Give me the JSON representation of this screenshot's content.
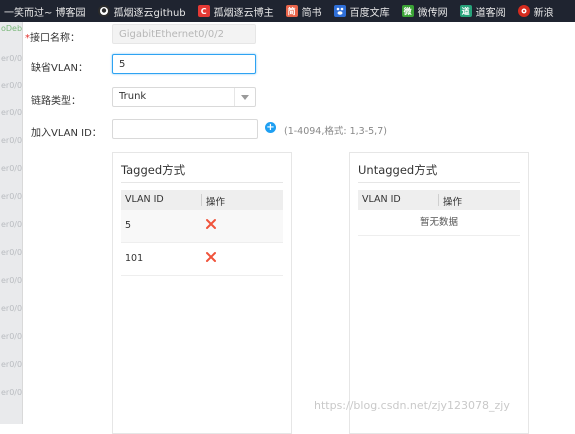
{
  "bookmarks": [
    {
      "label": "一笑而过~ 博客园",
      "icon": "none",
      "color": ""
    },
    {
      "label": "孤烟逐云github",
      "icon": "github-icon",
      "color": "#2b2b2b"
    },
    {
      "label": "孤烟逐云博主",
      "icon": "csdn-icon",
      "color": "#e53935"
    },
    {
      "label": "简书",
      "icon": "jianshu-icon",
      "color": "#e9644a"
    },
    {
      "label": "百度文库",
      "icon": "baidu-icon",
      "color": "#2f6fd8"
    },
    {
      "label": "微传网",
      "icon": "weichuan-icon",
      "color": "#3aa335"
    },
    {
      "label": "道客阅",
      "icon": "doc-icon",
      "color": "#27a37a"
    },
    {
      "label": "新浪",
      "icon": "weibo-icon",
      "color": "#d52b1e"
    }
  ],
  "bookmark_glyphs": {
    "jianshu": "简",
    "doc": "道",
    "weichuan": "微"
  },
  "background_rows": [
    "oDeb",
    "er0/0",
    "er0/0",
    "er0/0",
    "er0/0",
    "er0/0",
    "er0/0",
    "er0/0",
    "er0/0",
    "er0/0",
    "er0/0",
    "er0/0",
    "er0/0",
    "er0/0"
  ],
  "form": {
    "interface_name": {
      "label": "接口名称：",
      "required_mark": "*",
      "value": "GigabitEthernet0/0/2"
    },
    "default_vlan": {
      "label": "缺省VLAN：",
      "value": "5"
    },
    "link_type": {
      "label": "链路类型：",
      "value": "Trunk"
    },
    "join_vlan": {
      "label": "加入VLAN ID：",
      "value": "",
      "hint": "(1-4094,格式: 1,3-5,7)"
    }
  },
  "tagged": {
    "title": "Tagged方式",
    "columns": [
      "VLAN ID",
      "操作"
    ],
    "rows": [
      {
        "vlan": "5"
      },
      {
        "vlan": "101"
      }
    ]
  },
  "untagged": {
    "title": "Untagged方式",
    "columns": [
      "VLAN ID",
      "操作"
    ],
    "empty_text": "暂无数据"
  },
  "watermark": "https://blog.csdn.net/zjy123078_zjy",
  "colors": {
    "accent": "#1e9ff2",
    "delete": "#f0533b",
    "required": "#e2302c"
  }
}
